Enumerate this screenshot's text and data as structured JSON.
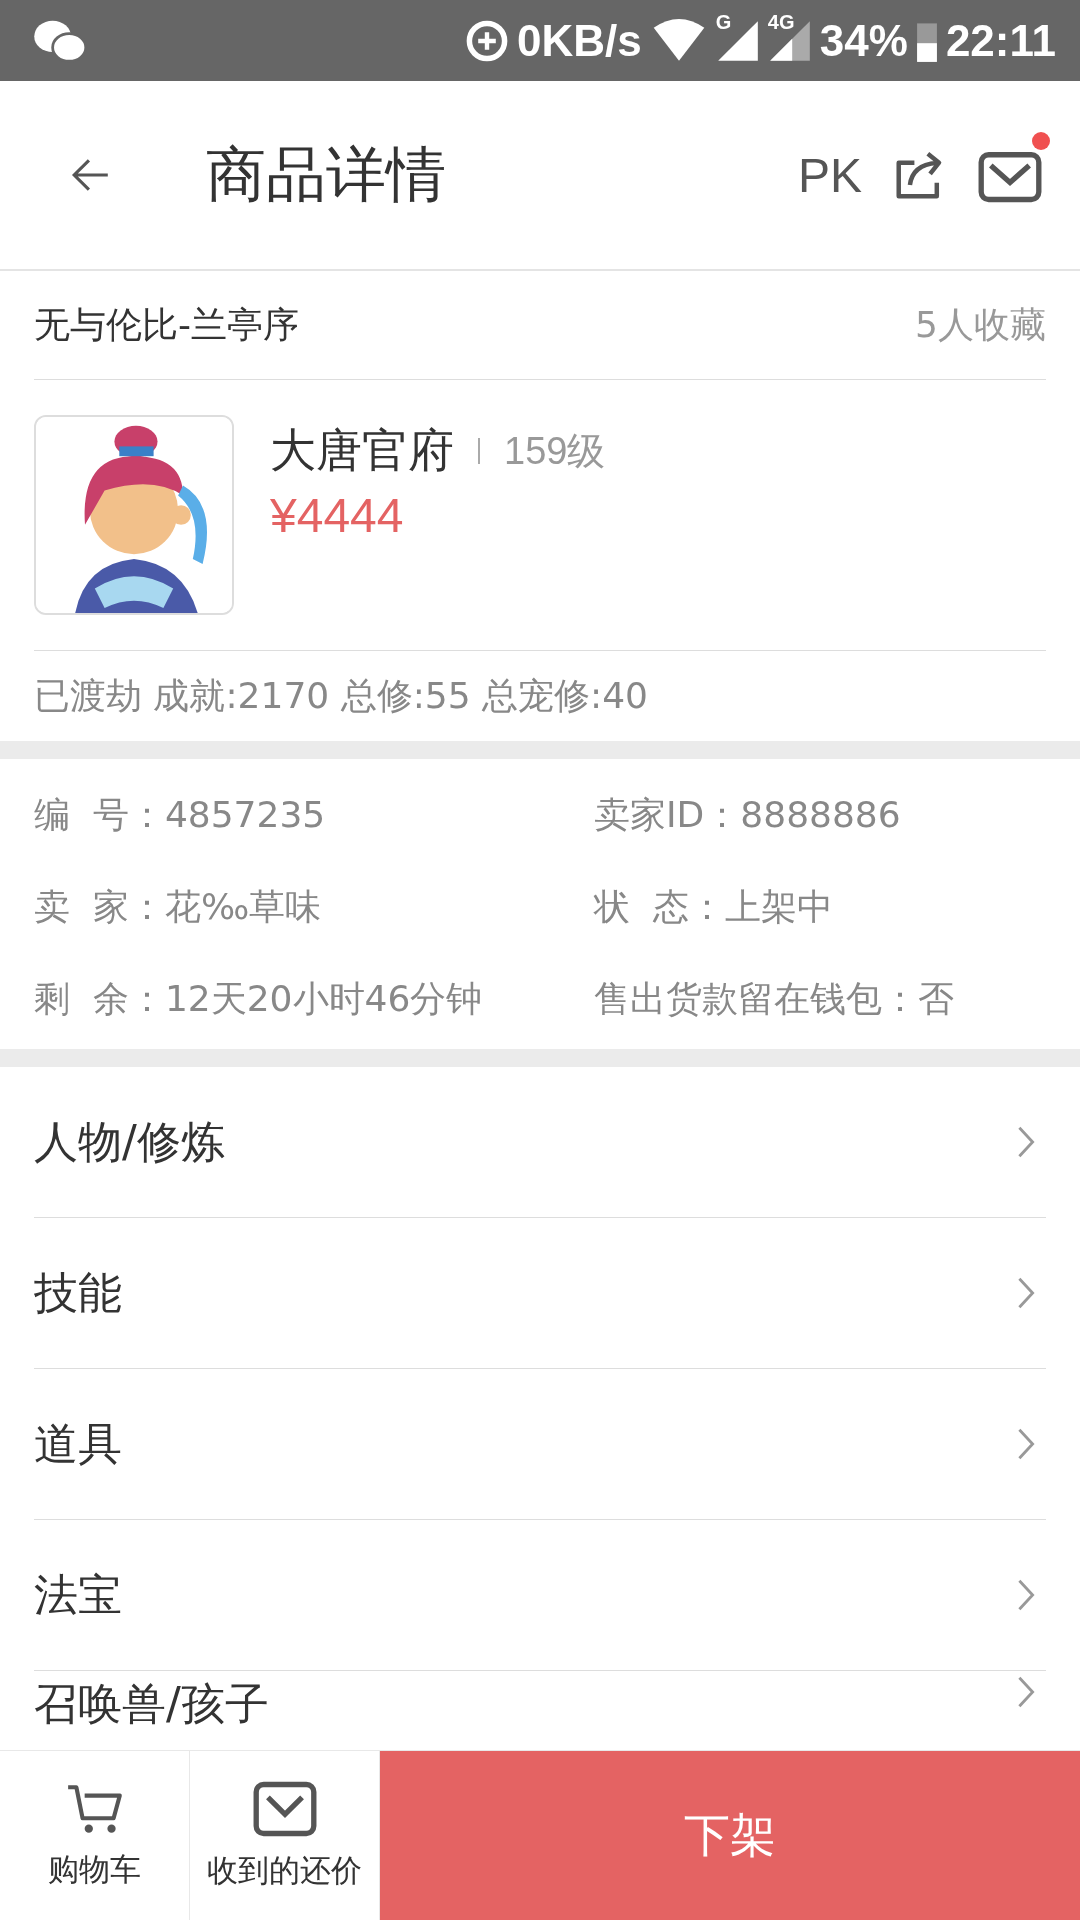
{
  "status_bar": {
    "speed": "0KB/s",
    "net1": "G",
    "net2": "4G",
    "battery": "34%",
    "time": "22:11"
  },
  "header": {
    "title": "商品详情",
    "pk": "PK",
    "has_unread": true
  },
  "item": {
    "name": "无与伦比-兰亭序",
    "favorites": "5人收藏"
  },
  "character": {
    "school": "大唐官府",
    "level": "159级",
    "price": "¥4444"
  },
  "stats": "已渡劫 成就:2170 总修:55 总宠修:40",
  "info": [
    {
      "label": "编  号：",
      "value": "4857235"
    },
    {
      "label": "卖家ID：",
      "value": "8888886"
    },
    {
      "label": "卖  家：",
      "value": "花‰草味"
    },
    {
      "label": "状  态：",
      "value": "上架中"
    },
    {
      "label": "剩  余：",
      "value": "12天20小时46分钟"
    },
    {
      "label": "售出货款留在钱包：",
      "value": "否"
    }
  ],
  "menu": [
    "人物/修炼",
    "技能",
    "道具",
    "法宝",
    "召唤兽/孩子"
  ],
  "bottom_bar": {
    "cart": "购物车",
    "offers": "收到的还价",
    "action": "下架"
  }
}
